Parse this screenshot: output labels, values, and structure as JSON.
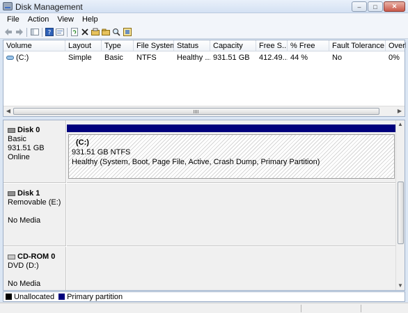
{
  "window": {
    "title": "Disk Management",
    "controls": {
      "minimize": "–",
      "maximize": "□",
      "close": "✕"
    }
  },
  "menu": [
    "File",
    "Action",
    "View",
    "Help"
  ],
  "toolbar": [
    "back-icon",
    "forward-icon",
    "show-hide-tree-icon",
    "help-icon",
    "properties-icon",
    "refresh-icon",
    "delete-icon",
    "open-icon",
    "explore-icon",
    "zoom-icon",
    "settings-icon"
  ],
  "volume_list": {
    "columns": [
      "Volume",
      "Layout",
      "Type",
      "File System",
      "Status",
      "Capacity",
      "Free S...",
      "% Free",
      "Fault Tolerance",
      "Overh"
    ],
    "rows": [
      [
        "(C:)",
        "Simple",
        "Basic",
        "NTFS",
        "Healthy ...",
        "931.51 GB",
        "412.49...",
        "44 %",
        "No",
        "0%"
      ]
    ]
  },
  "disks": [
    {
      "name": "Disk 0",
      "type": "Basic",
      "size": "931.51 GB",
      "state": "Online",
      "partition": {
        "name": "(C:)",
        "size_fs": "931.51 GB NTFS",
        "status": "Healthy (System, Boot, Page File, Active, Crash Dump, Primary Partition)"
      }
    },
    {
      "name": "Disk 1",
      "type": "Removable (E:)",
      "state": "No Media"
    },
    {
      "name": "CD-ROM 0",
      "type": "DVD (D:)",
      "state": "No Media"
    }
  ],
  "legend": [
    {
      "label": "Unallocated",
      "color": "#000000"
    },
    {
      "label": "Primary partition",
      "color": "#00007c"
    }
  ]
}
